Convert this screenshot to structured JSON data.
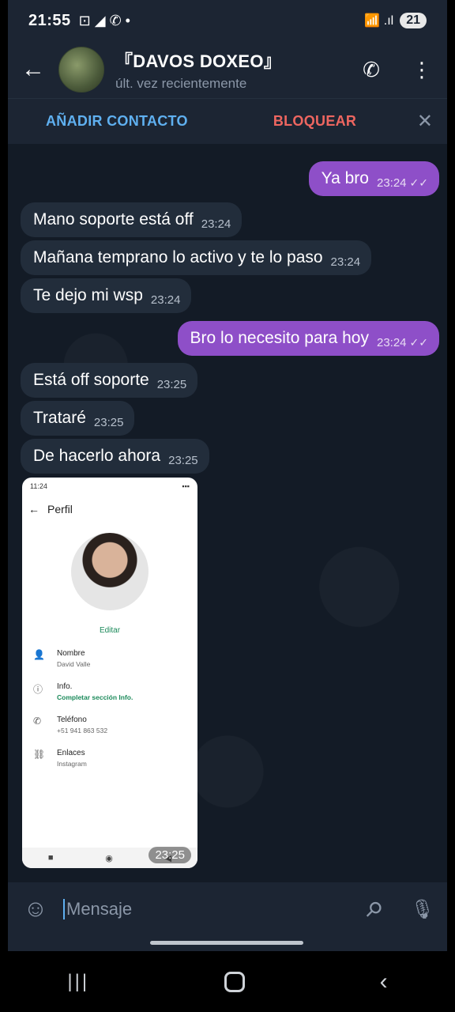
{
  "statusbar": {
    "time": "21:55",
    "icons_left": "⊡ ◢ ✆ •",
    "signal": "📶 .ıl",
    "battery": "21"
  },
  "header": {
    "title": "『DAVOS DOXEO』",
    "subtitle": "últ. vez recientemente"
  },
  "actions": {
    "add_contact": "AÑADIR CONTACTO",
    "block": "BLOQUEAR"
  },
  "messages": [
    {
      "dir": "out",
      "text": "Ya bro",
      "time": "23:24"
    },
    {
      "dir": "in",
      "text": "Mano soporte está off",
      "time": "23:24"
    },
    {
      "dir": "in",
      "text": "Mañana temprano lo activo y te lo paso",
      "time": "23:24"
    },
    {
      "dir": "in",
      "text": "Te dejo mi wsp",
      "time": "23:24"
    },
    {
      "dir": "out",
      "text": "Bro lo necesito para hoy",
      "time": "23:24"
    },
    {
      "dir": "in",
      "text": "Está off soporte",
      "time": "23:25"
    },
    {
      "dir": "in",
      "text": "Trataré",
      "time": "23:25"
    },
    {
      "dir": "in",
      "text": "De hacerlo ahora",
      "time": "23:25"
    }
  ],
  "image_message": {
    "time": "23:25",
    "status_time": "11:24",
    "screen_title": "Perfil",
    "edit": "Editar",
    "rows": [
      {
        "label": "Nombre",
        "value": "David Valle"
      },
      {
        "label": "Info.",
        "value": "Completar sección Info."
      },
      {
        "label": "Teléfono",
        "value": "+51 941 863 532"
      },
      {
        "label": "Enlaces",
        "value": "Instagram"
      }
    ]
  },
  "input": {
    "placeholder": "Mensaje"
  }
}
